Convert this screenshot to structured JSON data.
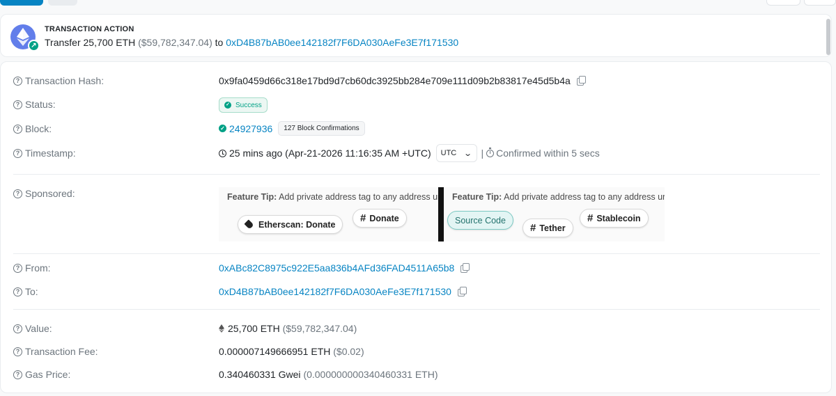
{
  "action": {
    "heading": "TRANSACTION ACTION",
    "prefix": "Transfer",
    "amount": "25,700 ETH",
    "usd": "($59,782,347.04)",
    "to_word": "to",
    "to_address": "0xD4B87bAB0ee142182f7F6DA030AeFe3E7f171530"
  },
  "labels": {
    "hash": "Transaction Hash:",
    "status": "Status:",
    "block": "Block:",
    "timestamp": "Timestamp:",
    "sponsored": "Sponsored:",
    "from": "From:",
    "to": "To:",
    "value": "Value:",
    "fee": "Transaction Fee:",
    "gas": "Gas Price:"
  },
  "tx": {
    "hash": "0x9fa0459d66c318e17bd9d7cb60dc3925bb284e709e111d09b2b83817e45d5b4a",
    "status": "Success",
    "block": "24927936",
    "confirmations": "127 Block Confirmations",
    "time_ago": "25 mins ago (Apr-21-2026 11:16:35 AM +UTC)",
    "tz": "UTC",
    "separator": "|",
    "confirmed": "Confirmed within 5 secs",
    "from": "0xABc82C8975c922E5aa836b4AFd36FAD4511A65b8",
    "to": "0xD4B87bAB0ee142182f7F6DA030AeFe3E7f171530",
    "value_eth": "25,700 ETH",
    "value_usd": "($59,782,347.04)",
    "fee_eth": "0.000007149666951 ETH",
    "fee_usd": "($0.02)",
    "gas_gwei": "0.340460331 Gwei",
    "gas_eth": "(0.000000000340460331 ETH)"
  },
  "sponsor": {
    "tip_bold": "Feature Tip:",
    "tip_text": "Add private address tag to any address under My Name Tag",
    "left_pills": [
      "Etherscan: Donate",
      "Donate"
    ],
    "right_pills": [
      "Source Code",
      "Tether",
      "Stablecoin"
    ]
  },
  "colors": {
    "link": "#0784c3",
    "success": "#00a186",
    "eth": "#627eea"
  },
  "icons": [
    "ethereum-icon",
    "arrow-up-right-icon",
    "question-icon",
    "copy-icon",
    "check-circle-icon",
    "clock-icon",
    "chevron-down-icon",
    "timer-icon",
    "eth-diamond-icon",
    "tag-icon",
    "hash-icon"
  ]
}
